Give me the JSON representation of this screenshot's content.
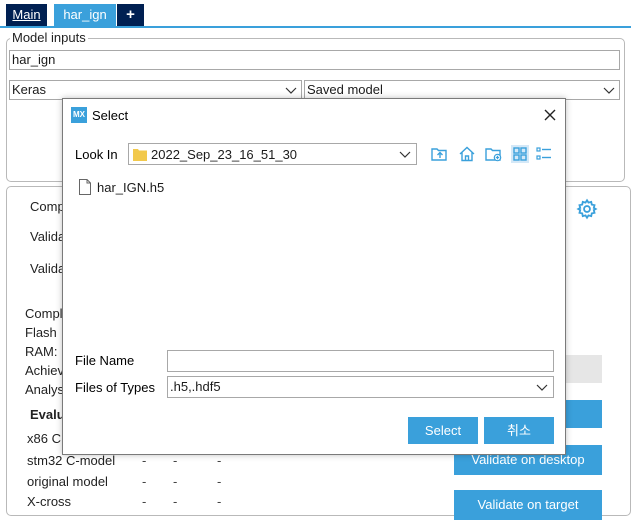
{
  "tabs": [
    {
      "label": "Main"
    },
    {
      "label": "har_ign"
    },
    {
      "label": "+"
    }
  ],
  "model_inputs": {
    "legend": "Model inputs",
    "name_value": "har_ign",
    "framework_value": "Keras",
    "model_type_value": "Saved model"
  },
  "background": {
    "labels": [
      "Comp",
      "Valida",
      "Valida",
      "Compl",
      "Flash",
      "RAM:",
      "Achiev",
      "Analys"
    ],
    "evaluation_heading": "Evalu",
    "rows": [
      {
        "label": "x86 C",
        "cells": []
      },
      {
        "label": "stm32 C-model",
        "cells": [
          "-",
          "-",
          "-"
        ]
      },
      {
        "label": "original model",
        "cells": [
          "-",
          "-",
          "-"
        ]
      },
      {
        "label": "X-cross",
        "cells": [
          "-",
          "-",
          "-"
        ]
      }
    ],
    "validate_desktop_label": "Validate on desktop",
    "validate_target_label": "Validate on target"
  },
  "dialog": {
    "icon_text": "MX",
    "title": "Select",
    "look_in_label": "Look In",
    "look_in_value": "2022_Sep_23_16_51_30",
    "files": [
      {
        "name": "har_IGN.h5"
      }
    ],
    "file_name_label": "File Name",
    "file_name_value": "",
    "files_of_type_label": "Files of Types",
    "files_of_type_value": ".h5,.hdf5",
    "select_button": "Select",
    "cancel_button": "취소"
  },
  "colors": {
    "accent": "#3aa0db",
    "navy": "#002052"
  }
}
